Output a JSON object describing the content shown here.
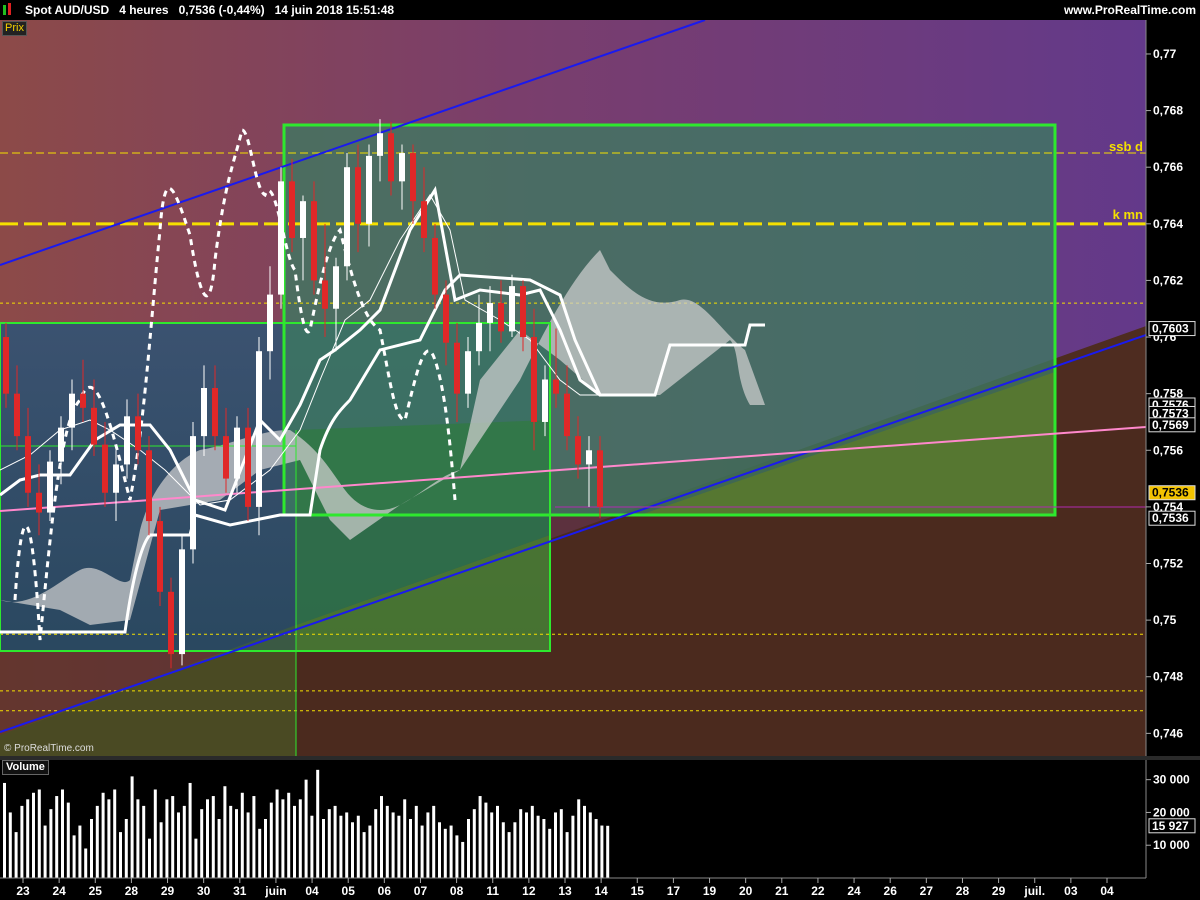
{
  "header": {
    "title": "Spot AUD/USD   4 heures   0,7536 (-0,44%)   14 juin 2018 15:51:48",
    "site": "www.ProRealTime.com"
  },
  "panels": {
    "price_label": "Prix",
    "volume_label": "Volume",
    "copyright": "© ProRealTime.com"
  },
  "chart_data": [
    {
      "type": "candlestick",
      "title": "Spot AUD/USD 4 heures",
      "ylim": [
        0.7452,
        0.7712
      ],
      "y_ticks": [
        {
          "v": 0.77,
          "label": "0,77"
        },
        {
          "v": 0.768,
          "label": "0,768"
        },
        {
          "v": 0.766,
          "label": "0,766"
        },
        {
          "v": 0.764,
          "label": "0,764"
        },
        {
          "v": 0.762,
          "label": "0,762"
        },
        {
          "v": 0.76,
          "label": "0,76"
        },
        {
          "v": 0.758,
          "label": "0,758"
        },
        {
          "v": 0.756,
          "label": "0,756"
        },
        {
          "v": 0.754,
          "label": "0,754"
        },
        {
          "v": 0.752,
          "label": "0,752"
        },
        {
          "v": 0.75,
          "label": "0,75"
        },
        {
          "v": 0.748,
          "label": "0,748"
        },
        {
          "v": 0.746,
          "label": "0,746"
        }
      ],
      "price_tags": [
        {
          "v": 0.7603,
          "label": "0,7603",
          "style": "box"
        },
        {
          "v": 0.7576,
          "label": "0,7576",
          "style": "box"
        },
        {
          "v": 0.7573,
          "label": "0,7573",
          "style": "box"
        },
        {
          "v": 0.7569,
          "label": "0,7569",
          "style": "box"
        },
        {
          "v": 0.7545,
          "label": "0,7536",
          "style": "current"
        },
        {
          "v": 0.7536,
          "label": "0,7536",
          "style": "box"
        }
      ],
      "x_labels": [
        "23",
        "24",
        "25",
        "28",
        "29",
        "30",
        "31",
        "juin",
        "04",
        "05",
        "06",
        "07",
        "08",
        "11",
        "12",
        "13",
        "14",
        "15",
        "17",
        "19",
        "20",
        "21",
        "22",
        "24",
        "26",
        "27",
        "28",
        "29",
        "juil.",
        "03",
        "04"
      ],
      "annotations": [
        {
          "text": "ssb d",
          "v": 0.7665,
          "color": "#f5e000"
        },
        {
          "text": "k mn",
          "v": 0.7641,
          "color": "#f5e000"
        }
      ],
      "horizontal_lines": [
        {
          "v": 0.7665,
          "style": "dashed-thin",
          "color": "#f5e000"
        },
        {
          "v": 0.764,
          "style": "dashed-thick",
          "color": "#f5e000"
        },
        {
          "v": 0.7612,
          "style": "dotted",
          "color": "#f5e000"
        },
        {
          "v": 0.7495,
          "style": "dotted",
          "color": "#f5e000"
        },
        {
          "v": 0.7475,
          "style": "dotted",
          "color": "#f5e000"
        },
        {
          "v": 0.7468,
          "style": "dotted",
          "color": "#f5e000"
        }
      ],
      "candles": [
        {
          "o": 0.76,
          "h": 0.7605,
          "l": 0.7575,
          "c": 0.758
        },
        {
          "o": 0.758,
          "h": 0.759,
          "l": 0.756,
          "c": 0.7565
        },
        {
          "o": 0.7565,
          "h": 0.7575,
          "l": 0.754,
          "c": 0.7545
        },
        {
          "o": 0.7545,
          "h": 0.7555,
          "l": 0.753,
          "c": 0.7538
        },
        {
          "o": 0.7538,
          "h": 0.756,
          "l": 0.7535,
          "c": 0.7556
        },
        {
          "o": 0.7556,
          "h": 0.7572,
          "l": 0.7548,
          "c": 0.7568
        },
        {
          "o": 0.7568,
          "h": 0.7585,
          "l": 0.756,
          "c": 0.758
        },
        {
          "o": 0.758,
          "h": 0.7592,
          "l": 0.757,
          "c": 0.7575
        },
        {
          "o": 0.7575,
          "h": 0.7585,
          "l": 0.7558,
          "c": 0.7562
        },
        {
          "o": 0.7562,
          "h": 0.757,
          "l": 0.754,
          "c": 0.7545
        },
        {
          "o": 0.7545,
          "h": 0.756,
          "l": 0.7535,
          "c": 0.7555
        },
        {
          "o": 0.7555,
          "h": 0.7578,
          "l": 0.755,
          "c": 0.7572
        },
        {
          "o": 0.7572,
          "h": 0.758,
          "l": 0.7555,
          "c": 0.756
        },
        {
          "o": 0.756,
          "h": 0.7565,
          "l": 0.753,
          "c": 0.7535
        },
        {
          "o": 0.7535,
          "h": 0.754,
          "l": 0.7505,
          "c": 0.751
        },
        {
          "o": 0.751,
          "h": 0.7515,
          "l": 0.7483,
          "c": 0.7488
        },
        {
          "o": 0.7488,
          "h": 0.753,
          "l": 0.7484,
          "c": 0.7525
        },
        {
          "o": 0.7525,
          "h": 0.757,
          "l": 0.752,
          "c": 0.7565
        },
        {
          "o": 0.7565,
          "h": 0.759,
          "l": 0.7558,
          "c": 0.7582
        },
        {
          "o": 0.7582,
          "h": 0.759,
          "l": 0.756,
          "c": 0.7565
        },
        {
          "o": 0.7565,
          "h": 0.7575,
          "l": 0.7545,
          "c": 0.755
        },
        {
          "o": 0.755,
          "h": 0.7572,
          "l": 0.7545,
          "c": 0.7568
        },
        {
          "o": 0.7568,
          "h": 0.7575,
          "l": 0.7535,
          "c": 0.754
        },
        {
          "o": 0.754,
          "h": 0.76,
          "l": 0.753,
          "c": 0.7595
        },
        {
          "o": 0.7595,
          "h": 0.7625,
          "l": 0.7585,
          "c": 0.7615
        },
        {
          "o": 0.7615,
          "h": 0.766,
          "l": 0.761,
          "c": 0.7655
        },
        {
          "o": 0.7655,
          "h": 0.7663,
          "l": 0.763,
          "c": 0.7635
        },
        {
          "o": 0.7635,
          "h": 0.765,
          "l": 0.762,
          "c": 0.7648
        },
        {
          "o": 0.7648,
          "h": 0.7655,
          "l": 0.7615,
          "c": 0.762
        },
        {
          "o": 0.762,
          "h": 0.764,
          "l": 0.76,
          "c": 0.761
        },
        {
          "o": 0.761,
          "h": 0.7628,
          "l": 0.7595,
          "c": 0.7625
        },
        {
          "o": 0.7625,
          "h": 0.7665,
          "l": 0.762,
          "c": 0.766
        },
        {
          "o": 0.766,
          "h": 0.7668,
          "l": 0.763,
          "c": 0.764
        },
        {
          "o": 0.764,
          "h": 0.7668,
          "l": 0.7632,
          "c": 0.7664
        },
        {
          "o": 0.7664,
          "h": 0.7677,
          "l": 0.7655,
          "c": 0.7672
        },
        {
          "o": 0.7672,
          "h": 0.7676,
          "l": 0.765,
          "c": 0.7655
        },
        {
          "o": 0.7655,
          "h": 0.7668,
          "l": 0.7645,
          "c": 0.7665
        },
        {
          "o": 0.7665,
          "h": 0.7668,
          "l": 0.764,
          "c": 0.7648
        },
        {
          "o": 0.7648,
          "h": 0.766,
          "l": 0.763,
          "c": 0.7635
        },
        {
          "o": 0.7635,
          "h": 0.764,
          "l": 0.761,
          "c": 0.7615
        },
        {
          "o": 0.7615,
          "h": 0.762,
          "l": 0.759,
          "c": 0.7598
        },
        {
          "o": 0.7598,
          "h": 0.7605,
          "l": 0.757,
          "c": 0.758
        },
        {
          "o": 0.758,
          "h": 0.76,
          "l": 0.7575,
          "c": 0.7595
        },
        {
          "o": 0.7595,
          "h": 0.7615,
          "l": 0.759,
          "c": 0.7605
        },
        {
          "o": 0.7605,
          "h": 0.7618,
          "l": 0.7595,
          "c": 0.7612
        },
        {
          "o": 0.7612,
          "h": 0.762,
          "l": 0.7598,
          "c": 0.7602
        },
        {
          "o": 0.7602,
          "h": 0.7622,
          "l": 0.76,
          "c": 0.7618
        },
        {
          "o": 0.7618,
          "h": 0.762,
          "l": 0.7595,
          "c": 0.76
        },
        {
          "o": 0.76,
          "h": 0.761,
          "l": 0.756,
          "c": 0.757
        },
        {
          "o": 0.757,
          "h": 0.759,
          "l": 0.7565,
          "c": 0.7585
        },
        {
          "o": 0.7585,
          "h": 0.7603,
          "l": 0.7575,
          "c": 0.758
        },
        {
          "o": 0.758,
          "h": 0.759,
          "l": 0.756,
          "c": 0.7565
        },
        {
          "o": 0.7565,
          "h": 0.7572,
          "l": 0.755,
          "c": 0.7555
        },
        {
          "o": 0.7555,
          "h": 0.7565,
          "l": 0.754,
          "c": 0.756
        },
        {
          "o": 0.756,
          "h": 0.7565,
          "l": 0.7536,
          "c": 0.754
        }
      ],
      "volume": {
        "ylim": [
          0,
          36000
        ],
        "y_ticks": [
          {
            "v": 30000,
            "label": "30 000"
          },
          {
            "v": 20000,
            "label": "20 000"
          },
          {
            "v": 10000,
            "label": "10 000"
          }
        ],
        "current_label": "15 927",
        "current_value": 15927,
        "values": [
          29000,
          20000,
          14000,
          22000,
          24000,
          26000,
          27000,
          16000,
          21000,
          25000,
          27000,
          23000,
          13000,
          16000,
          9000,
          18000,
          22000,
          26000,
          24000,
          27000,
          14000,
          18000,
          31000,
          24000,
          22000,
          12000,
          27000,
          17000,
          24000,
          25000,
          20000,
          22000,
          29000,
          12000,
          21000,
          24000,
          25000,
          18000,
          28000,
          22000,
          21000,
          26000,
          20000,
          25000,
          15000,
          18000,
          23000,
          27000,
          24000,
          26000,
          22000,
          24000,
          30000,
          19000,
          33000,
          18000,
          21000,
          22000,
          19000,
          20000,
          17000,
          19000,
          14000,
          16000,
          21000,
          25000,
          22000,
          20000,
          19000,
          24000,
          18000,
          22000,
          16000,
          20000,
          22000,
          17000,
          15000,
          16000,
          13000,
          11000,
          18000,
          21000,
          25000,
          23000,
          20000,
          22000,
          17000,
          14000,
          17000,
          21000,
          20000,
          22000,
          19000,
          18000,
          15000,
          20000,
          21000,
          14000,
          19000,
          24000,
          22000,
          20000,
          18000,
          16000,
          15927
        ]
      }
    }
  ]
}
